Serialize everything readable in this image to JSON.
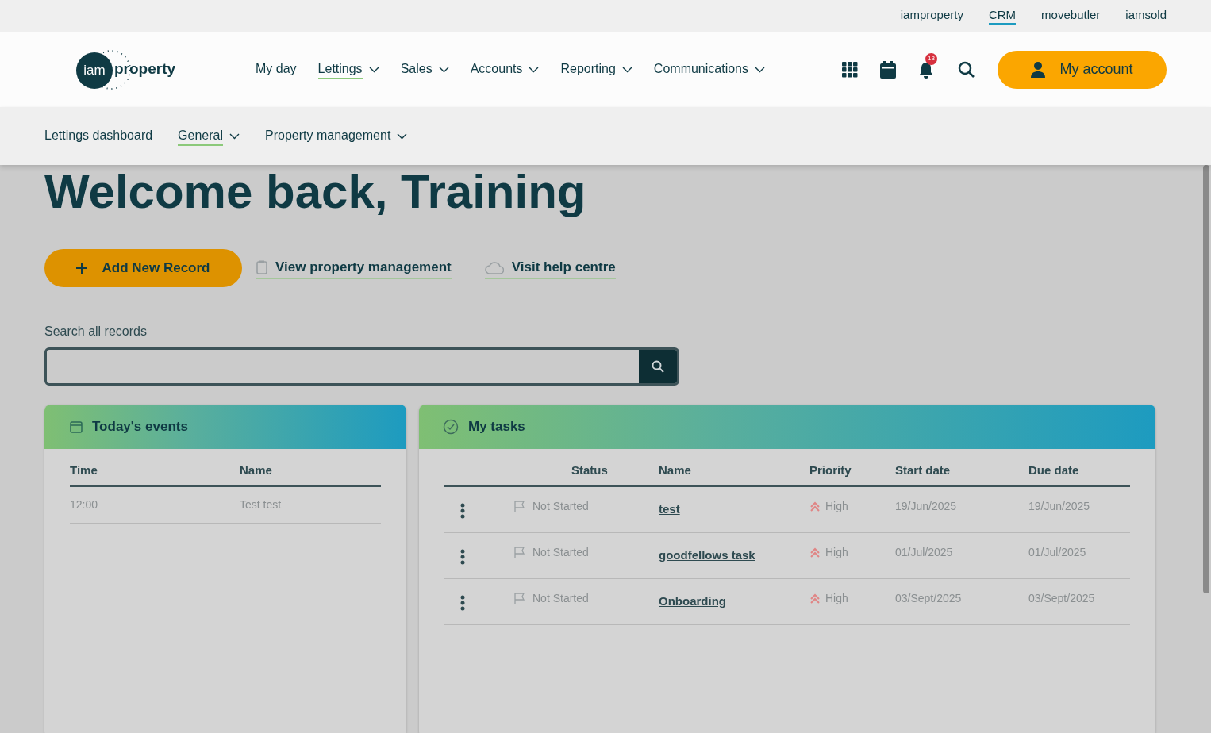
{
  "brand_links": [
    {
      "label": "iamproperty",
      "selected": false
    },
    {
      "label": "CRM",
      "selected": true
    },
    {
      "label": "movebutler",
      "selected": false
    },
    {
      "label": "iamsold",
      "selected": false
    }
  ],
  "logo": {
    "mark": "iam",
    "word": "property"
  },
  "main_nav": [
    {
      "label": "My day",
      "selected": false,
      "dropdown": false
    },
    {
      "label": "Lettings",
      "selected": true,
      "dropdown": true
    },
    {
      "label": "Sales",
      "selected": false,
      "dropdown": true
    },
    {
      "label": "Accounts",
      "selected": false,
      "dropdown": true
    },
    {
      "label": "Reporting",
      "selected": false,
      "dropdown": true
    },
    {
      "label": "Communications",
      "selected": false,
      "dropdown": true
    }
  ],
  "notifications": {
    "count": "13"
  },
  "account_button": "My account",
  "sub_nav": [
    {
      "label": "Lettings dashboard",
      "selected": false,
      "dropdown": false
    },
    {
      "label": "General",
      "selected": true,
      "dropdown": true
    },
    {
      "label": "Property management",
      "selected": false,
      "dropdown": true
    }
  ],
  "page": {
    "heading": "Welcome back, Training",
    "actions": [
      {
        "kind": "button",
        "label": "Add New Record"
      },
      {
        "kind": "clipboard-link",
        "label": "View property management"
      },
      {
        "kind": "cloud-link",
        "label": "Visit help centre"
      }
    ],
    "search": {
      "label": "Search all records"
    },
    "events": {
      "title": "Today's events",
      "columns": [
        "Time",
        "Name"
      ],
      "rows": [
        [
          "12:00",
          "Test test"
        ]
      ]
    },
    "tasks": {
      "title": "My tasks",
      "columns": [
        "Status",
        "Name",
        "Priority",
        "Start date",
        "Due date"
      ],
      "rows": [
        {
          "status": "Not Started",
          "name": "test",
          "priority": "High",
          "start": "19/Jun/2025",
          "due": "19/Jun/2025"
        },
        {
          "status": "Not Started",
          "name": "goodfellows task",
          "priority": "High",
          "start": "01/Jul/2025",
          "due": "01/Jul/2025"
        },
        {
          "status": "Not Started",
          "name": "Onboarding",
          "priority": "High",
          "start": "03/Sept/2025",
          "due": "03/Sept/2025"
        }
      ]
    }
  }
}
